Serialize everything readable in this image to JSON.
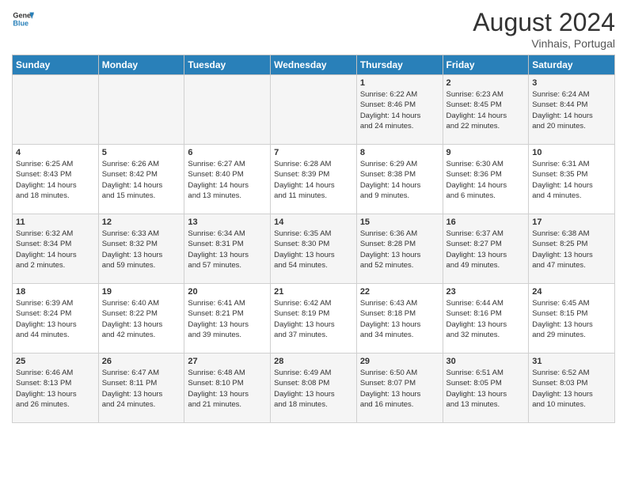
{
  "header": {
    "logo_general": "General",
    "logo_blue": "Blue",
    "month_year": "August 2024",
    "location": "Vinhais, Portugal"
  },
  "days_of_week": [
    "Sunday",
    "Monday",
    "Tuesday",
    "Wednesday",
    "Thursday",
    "Friday",
    "Saturday"
  ],
  "weeks": [
    [
      {
        "day": "",
        "info": ""
      },
      {
        "day": "",
        "info": ""
      },
      {
        "day": "",
        "info": ""
      },
      {
        "day": "",
        "info": ""
      },
      {
        "day": "1",
        "info": "Sunrise: 6:22 AM\nSunset: 8:46 PM\nDaylight: 14 hours\nand 24 minutes."
      },
      {
        "day": "2",
        "info": "Sunrise: 6:23 AM\nSunset: 8:45 PM\nDaylight: 14 hours\nand 22 minutes."
      },
      {
        "day": "3",
        "info": "Sunrise: 6:24 AM\nSunset: 8:44 PM\nDaylight: 14 hours\nand 20 minutes."
      }
    ],
    [
      {
        "day": "4",
        "info": "Sunrise: 6:25 AM\nSunset: 8:43 PM\nDaylight: 14 hours\nand 18 minutes."
      },
      {
        "day": "5",
        "info": "Sunrise: 6:26 AM\nSunset: 8:42 PM\nDaylight: 14 hours\nand 15 minutes."
      },
      {
        "day": "6",
        "info": "Sunrise: 6:27 AM\nSunset: 8:40 PM\nDaylight: 14 hours\nand 13 minutes."
      },
      {
        "day": "7",
        "info": "Sunrise: 6:28 AM\nSunset: 8:39 PM\nDaylight: 14 hours\nand 11 minutes."
      },
      {
        "day": "8",
        "info": "Sunrise: 6:29 AM\nSunset: 8:38 PM\nDaylight: 14 hours\nand 9 minutes."
      },
      {
        "day": "9",
        "info": "Sunrise: 6:30 AM\nSunset: 8:36 PM\nDaylight: 14 hours\nand 6 minutes."
      },
      {
        "day": "10",
        "info": "Sunrise: 6:31 AM\nSunset: 8:35 PM\nDaylight: 14 hours\nand 4 minutes."
      }
    ],
    [
      {
        "day": "11",
        "info": "Sunrise: 6:32 AM\nSunset: 8:34 PM\nDaylight: 14 hours\nand 2 minutes."
      },
      {
        "day": "12",
        "info": "Sunrise: 6:33 AM\nSunset: 8:32 PM\nDaylight: 13 hours\nand 59 minutes."
      },
      {
        "day": "13",
        "info": "Sunrise: 6:34 AM\nSunset: 8:31 PM\nDaylight: 13 hours\nand 57 minutes."
      },
      {
        "day": "14",
        "info": "Sunrise: 6:35 AM\nSunset: 8:30 PM\nDaylight: 13 hours\nand 54 minutes."
      },
      {
        "day": "15",
        "info": "Sunrise: 6:36 AM\nSunset: 8:28 PM\nDaylight: 13 hours\nand 52 minutes."
      },
      {
        "day": "16",
        "info": "Sunrise: 6:37 AM\nSunset: 8:27 PM\nDaylight: 13 hours\nand 49 minutes."
      },
      {
        "day": "17",
        "info": "Sunrise: 6:38 AM\nSunset: 8:25 PM\nDaylight: 13 hours\nand 47 minutes."
      }
    ],
    [
      {
        "day": "18",
        "info": "Sunrise: 6:39 AM\nSunset: 8:24 PM\nDaylight: 13 hours\nand 44 minutes."
      },
      {
        "day": "19",
        "info": "Sunrise: 6:40 AM\nSunset: 8:22 PM\nDaylight: 13 hours\nand 42 minutes."
      },
      {
        "day": "20",
        "info": "Sunrise: 6:41 AM\nSunset: 8:21 PM\nDaylight: 13 hours\nand 39 minutes."
      },
      {
        "day": "21",
        "info": "Sunrise: 6:42 AM\nSunset: 8:19 PM\nDaylight: 13 hours\nand 37 minutes."
      },
      {
        "day": "22",
        "info": "Sunrise: 6:43 AM\nSunset: 8:18 PM\nDaylight: 13 hours\nand 34 minutes."
      },
      {
        "day": "23",
        "info": "Sunrise: 6:44 AM\nSunset: 8:16 PM\nDaylight: 13 hours\nand 32 minutes."
      },
      {
        "day": "24",
        "info": "Sunrise: 6:45 AM\nSunset: 8:15 PM\nDaylight: 13 hours\nand 29 minutes."
      }
    ],
    [
      {
        "day": "25",
        "info": "Sunrise: 6:46 AM\nSunset: 8:13 PM\nDaylight: 13 hours\nand 26 minutes."
      },
      {
        "day": "26",
        "info": "Sunrise: 6:47 AM\nSunset: 8:11 PM\nDaylight: 13 hours\nand 24 minutes."
      },
      {
        "day": "27",
        "info": "Sunrise: 6:48 AM\nSunset: 8:10 PM\nDaylight: 13 hours\nand 21 minutes."
      },
      {
        "day": "28",
        "info": "Sunrise: 6:49 AM\nSunset: 8:08 PM\nDaylight: 13 hours\nand 18 minutes."
      },
      {
        "day": "29",
        "info": "Sunrise: 6:50 AM\nSunset: 8:07 PM\nDaylight: 13 hours\nand 16 minutes."
      },
      {
        "day": "30",
        "info": "Sunrise: 6:51 AM\nSunset: 8:05 PM\nDaylight: 13 hours\nand 13 minutes."
      },
      {
        "day": "31",
        "info": "Sunrise: 6:52 AM\nSunset: 8:03 PM\nDaylight: 13 hours\nand 10 minutes."
      }
    ]
  ]
}
